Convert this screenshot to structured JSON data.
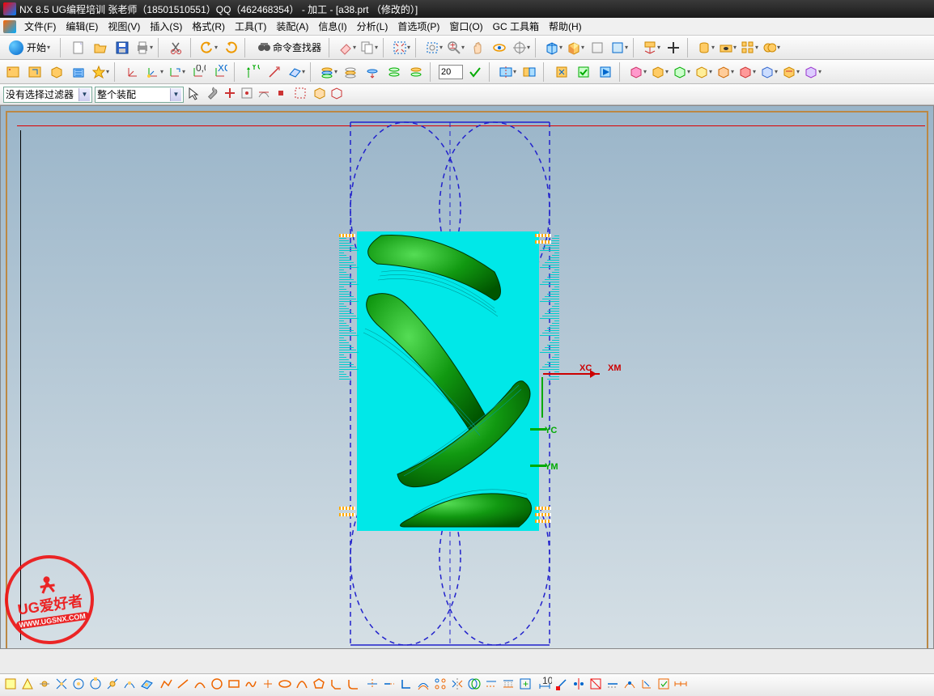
{
  "title": "NX 8.5  UG编程培训 张老师（18501510551）QQ（462468354） - 加工 - [a38.prt （修改的）]",
  "menu": {
    "file": "文件(F)",
    "edit": "编辑(E)",
    "view": "视图(V)",
    "insert": "插入(S)",
    "format": "格式(R)",
    "tools": "工具(T)",
    "assemblies": "装配(A)",
    "info": "信息(I)",
    "analysis": "分析(L)",
    "preferences": "首选项(P)",
    "window": "窗口(O)",
    "gctoolbox": "GC 工具箱",
    "help": "帮助(H)"
  },
  "toolbar1": {
    "start": "开始"
  },
  "toolbar1_cmd": {
    "label": "命令查找器"
  },
  "toolbar2_input": "20",
  "filter": {
    "combo1": "没有选择过滤器",
    "combo2": "整个装配"
  },
  "axes": {
    "xc": "XC",
    "xm": "XM",
    "yc": "YC",
    "ym": "YM"
  },
  "watermark": {
    "line1": "UG爱好者",
    "line2": "WWW.UGSNX.COM"
  },
  "icons": {
    "new": "new-icon",
    "open": "open-icon",
    "save": "save-icon",
    "print": "print-icon",
    "cut": "cut-icon",
    "undo": "undo-icon",
    "redo": "redo-icon"
  }
}
